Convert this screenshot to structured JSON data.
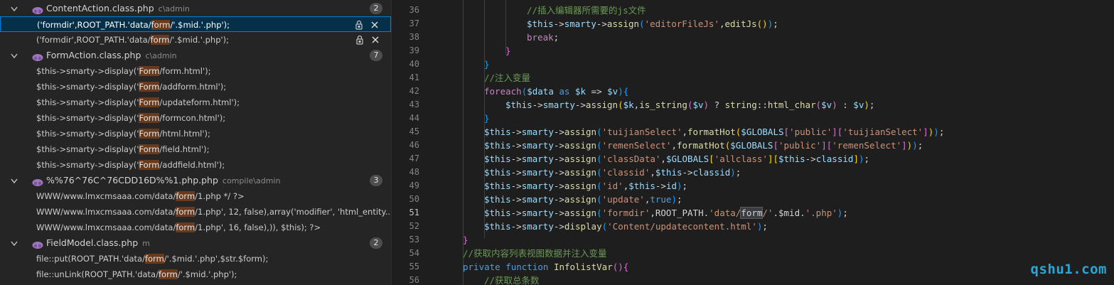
{
  "search_results": {
    "groups": [
      {
        "file": "ContentAction.class.php",
        "path": "c\\admin",
        "count": "2",
        "matches": [
          {
            "pre": "('formdir',ROOT_PATH.'data/",
            "hit": "form",
            "post": "/'.$mid.'.php');",
            "selected": true
          },
          {
            "pre": "('formdir',ROOT_PATH.'data/",
            "hit": "form",
            "post": "/'.$mid.'.php');",
            "selected": false
          }
        ]
      },
      {
        "file": "FormAction.class.php",
        "path": "c\\admin",
        "count": "7",
        "matches": [
          {
            "pre": "$this->smarty->display('",
            "hit": "Form",
            "post": "/form.html');"
          },
          {
            "pre": "$this->smarty->display('",
            "hit": "Form",
            "post": "/addform.html');"
          },
          {
            "pre": "$this->smarty->display('",
            "hit": "Form",
            "post": "/updateform.html');"
          },
          {
            "pre": "$this->smarty->display('",
            "hit": "Form",
            "post": "/formcon.html');"
          },
          {
            "pre": "$this->smarty->display('",
            "hit": "Form",
            "post": "/html.html');"
          },
          {
            "pre": "$this->smarty->display('",
            "hit": "Form",
            "post": "/field.html');"
          },
          {
            "pre": "$this->smarty->display('",
            "hit": "Form",
            "post": "/addfield.html');"
          }
        ]
      },
      {
        "file": "%%76^76C^76CDD16D%%1.php.php",
        "path": "compile\\admin",
        "count": "3",
        "matches": [
          {
            "pre": "WWW/www.lmxcmsaaa.com/data/",
            "hit": "form",
            "post": "/1.php */ ?>"
          },
          {
            "pre": "WWW/www.lmxcmsaaa.com/data/",
            "hit": "form",
            "post": "/1.php', 12, false),array('modifier', 'html_entity..."
          },
          {
            "pre": "WWW/www.lmxcmsaaa.com/data/",
            "hit": "form",
            "post": "/1.php', 16, false),)), $this); ?>"
          }
        ]
      },
      {
        "file": "FieldModel.class.php",
        "path": "m",
        "count": "2",
        "matches": [
          {
            "pre": "file::put(ROOT_PATH.'data/",
            "hit": "form",
            "post": "/'.$mid.'.php',$str.$form);"
          },
          {
            "pre": "file::unLink(ROOT_PATH.'data/",
            "hit": "form",
            "post": "/'.$mid.'.php');"
          }
        ]
      }
    ]
  },
  "editor": {
    "active_line": "51",
    "lines": [
      {
        "n": "36",
        "tokens": [
          [
            "cm",
            "//插入编辑器所需要的js文件"
          ]
        ]
      },
      {
        "n": "37",
        "tokens": [
          [
            "vr",
            "$this"
          ],
          [
            "",
            "->"
          ],
          [
            "vr",
            "smarty"
          ],
          [
            "",
            "->"
          ],
          [
            "fn",
            "assign"
          ],
          [
            "br3",
            "("
          ],
          [
            "st",
            "'editorFileJs'"
          ],
          [
            "",
            ","
          ],
          [
            "fn",
            "editJs"
          ],
          [
            "br1",
            "()"
          ],
          [
            "br3",
            ")"
          ],
          [
            "",
            ";"
          ]
        ]
      },
      {
        "n": "38",
        "tokens": [
          [
            "kw2",
            "break"
          ],
          [
            "",
            ";"
          ]
        ]
      },
      {
        "n": "39",
        "tokens": [
          [
            "br2",
            "}"
          ]
        ]
      },
      {
        "n": "40",
        "tokens": [
          [
            "br3",
            "}"
          ]
        ]
      },
      {
        "n": "41",
        "tokens": [
          [
            "cm",
            "//注入变量"
          ]
        ]
      },
      {
        "n": "42",
        "tokens": [
          [
            "kw2",
            "foreach"
          ],
          [
            "br3",
            "("
          ],
          [
            "vr",
            "$data"
          ],
          [
            "kw",
            " as "
          ],
          [
            "vr",
            "$k"
          ],
          [
            "",
            " => "
          ],
          [
            "vr",
            "$v"
          ],
          [
            "br3",
            ")"
          ],
          [
            "br3",
            "{"
          ]
        ]
      },
      {
        "n": "43",
        "tokens": [
          [
            "vr",
            "$this"
          ],
          [
            "",
            "->"
          ],
          [
            "vr",
            "smarty"
          ],
          [
            "",
            "->"
          ],
          [
            "fn",
            "assign"
          ],
          [
            "br1",
            "("
          ],
          [
            "vr",
            "$k"
          ],
          [
            "",
            ","
          ],
          [
            "fn",
            "is_string"
          ],
          [
            "br2",
            "("
          ],
          [
            "vr",
            "$v"
          ],
          [
            "br2",
            ")"
          ],
          [
            "",
            " ? "
          ],
          [
            "fn",
            "string"
          ],
          [
            "",
            "::"
          ],
          [
            "fn",
            "html_char"
          ],
          [
            "br2",
            "("
          ],
          [
            "vr",
            "$v"
          ],
          [
            "br2",
            ")"
          ],
          [
            "",
            " : "
          ],
          [
            "vr",
            "$v"
          ],
          [
            "br1",
            ")"
          ],
          [
            "",
            ";"
          ]
        ]
      },
      {
        "n": "44",
        "tokens": [
          [
            "br3",
            "}"
          ]
        ]
      },
      {
        "n": "45",
        "tokens": [
          [
            "vr",
            "$this"
          ],
          [
            "",
            "->"
          ],
          [
            "vr",
            "smarty"
          ],
          [
            "",
            "->"
          ],
          [
            "fn",
            "assign"
          ],
          [
            "br3",
            "("
          ],
          [
            "st",
            "'tuijianSelect'"
          ],
          [
            "",
            ","
          ],
          [
            "fn",
            "formatHot"
          ],
          [
            "br1",
            "("
          ],
          [
            "vr",
            "$GLOBALS"
          ],
          [
            "br2",
            "["
          ],
          [
            "st",
            "'public'"
          ],
          [
            "br2",
            "]["
          ],
          [
            "st",
            "'tuijianSelect'"
          ],
          [
            "br2",
            "]"
          ],
          [
            "br1",
            ")"
          ],
          [
            "br3",
            ")"
          ],
          [
            "",
            ";"
          ]
        ]
      },
      {
        "n": "46",
        "tokens": [
          [
            "vr",
            "$this"
          ],
          [
            "",
            "->"
          ],
          [
            "vr",
            "smarty"
          ],
          [
            "",
            "->"
          ],
          [
            "fn",
            "assign"
          ],
          [
            "br3",
            "("
          ],
          [
            "st",
            "'remenSelect'"
          ],
          [
            "",
            ","
          ],
          [
            "fn",
            "formatHot"
          ],
          [
            "br1",
            "("
          ],
          [
            "vr",
            "$GLOBALS"
          ],
          [
            "br2",
            "["
          ],
          [
            "st",
            "'public'"
          ],
          [
            "br2",
            "]["
          ],
          [
            "st",
            "'remenSelect'"
          ],
          [
            "br2",
            "]"
          ],
          [
            "br1",
            ")"
          ],
          [
            "br3",
            ")"
          ],
          [
            "",
            ";"
          ]
        ]
      },
      {
        "n": "47",
        "tokens": [
          [
            "vr",
            "$this"
          ],
          [
            "",
            "->"
          ],
          [
            "vr",
            "smarty"
          ],
          [
            "",
            "->"
          ],
          [
            "fn",
            "assign"
          ],
          [
            "br3",
            "("
          ],
          [
            "st",
            "'classData'"
          ],
          [
            "",
            ","
          ],
          [
            "vr",
            "$GLOBALS"
          ],
          [
            "br1",
            "["
          ],
          [
            "st",
            "'allclass'"
          ],
          [
            "br1",
            "]"
          ],
          [
            "br1",
            "["
          ],
          [
            "vr",
            "$this"
          ],
          [
            "",
            "->"
          ],
          [
            "vr",
            "classid"
          ],
          [
            "br1",
            "]"
          ],
          [
            "br3",
            ")"
          ],
          [
            "",
            ";"
          ]
        ]
      },
      {
        "n": "48",
        "tokens": [
          [
            "vr",
            "$this"
          ],
          [
            "",
            "->"
          ],
          [
            "vr",
            "smarty"
          ],
          [
            "",
            "->"
          ],
          [
            "fn",
            "assign"
          ],
          [
            "br3",
            "("
          ],
          [
            "st",
            "'classid'"
          ],
          [
            "",
            ","
          ],
          [
            "vr",
            "$this"
          ],
          [
            "",
            "->"
          ],
          [
            "vr",
            "classid"
          ],
          [
            "br3",
            ")"
          ],
          [
            "",
            ";"
          ]
        ]
      },
      {
        "n": "49",
        "tokens": [
          [
            "vr",
            "$this"
          ],
          [
            "",
            "->"
          ],
          [
            "vr",
            "smarty"
          ],
          [
            "",
            "->"
          ],
          [
            "fn",
            "assign"
          ],
          [
            "br3",
            "("
          ],
          [
            "st",
            "'id'"
          ],
          [
            "",
            ","
          ],
          [
            "vr",
            "$this"
          ],
          [
            "",
            "->"
          ],
          [
            "vr",
            "id"
          ],
          [
            "br3",
            ")"
          ],
          [
            "",
            ";"
          ]
        ]
      },
      {
        "n": "50",
        "tokens": [
          [
            "vr",
            "$this"
          ],
          [
            "",
            "->"
          ],
          [
            "vr",
            "smarty"
          ],
          [
            "",
            "->"
          ],
          [
            "fn",
            "assign"
          ],
          [
            "br3",
            "("
          ],
          [
            "st",
            "'update'"
          ],
          [
            "",
            ","
          ],
          [
            "kw",
            "true"
          ],
          [
            "br3",
            ")"
          ],
          [
            "",
            ";"
          ]
        ]
      },
      {
        "n": "51",
        "tokens": [
          [
            "vr",
            "$this"
          ],
          [
            "",
            "->"
          ],
          [
            "vr",
            "smarty"
          ],
          [
            "",
            "->"
          ],
          [
            "fn",
            "assign"
          ],
          [
            "br3",
            "("
          ],
          [
            "st",
            "'formdir'"
          ],
          [
            "",
            ",ROOT_PATH."
          ],
          [
            "st",
            "'data/"
          ],
          [
            "box",
            "form"
          ],
          [
            "st",
            "/'"
          ],
          [
            "",
            ".$mid."
          ],
          [
            "st",
            "'.php'"
          ],
          [
            "br3",
            ")"
          ],
          [
            "",
            ";"
          ]
        ]
      },
      {
        "n": "52",
        "tokens": [
          [
            "vr",
            "$this"
          ],
          [
            "",
            "->"
          ],
          [
            "vr",
            "smarty"
          ],
          [
            "",
            "->"
          ],
          [
            "fn",
            "display"
          ],
          [
            "br3",
            "("
          ],
          [
            "st",
            "'Content/updatecontent.html'"
          ],
          [
            "br3",
            ")"
          ],
          [
            "",
            ";"
          ]
        ]
      },
      {
        "n": "53",
        "tokens": [
          [
            "br2",
            "}"
          ]
        ]
      },
      {
        "n": "54",
        "tokens": [
          [
            "cm",
            "//获取内容列表视图数据并注入变量"
          ]
        ]
      },
      {
        "n": "55",
        "tokens": [
          [
            "kw",
            "private function "
          ],
          [
            "fn",
            "InfolistVar"
          ],
          [
            "br2",
            "()"
          ],
          [
            "br2",
            "{"
          ]
        ]
      },
      {
        "n": "56",
        "tokens": [
          [
            "cm",
            "//获取总条数"
          ]
        ]
      }
    ]
  },
  "watermark": "qshu1.com",
  "colors": {
    "accent": "#007fd4",
    "match_highlight": "#6a3a1d",
    "php_icon": "#a074c4"
  }
}
